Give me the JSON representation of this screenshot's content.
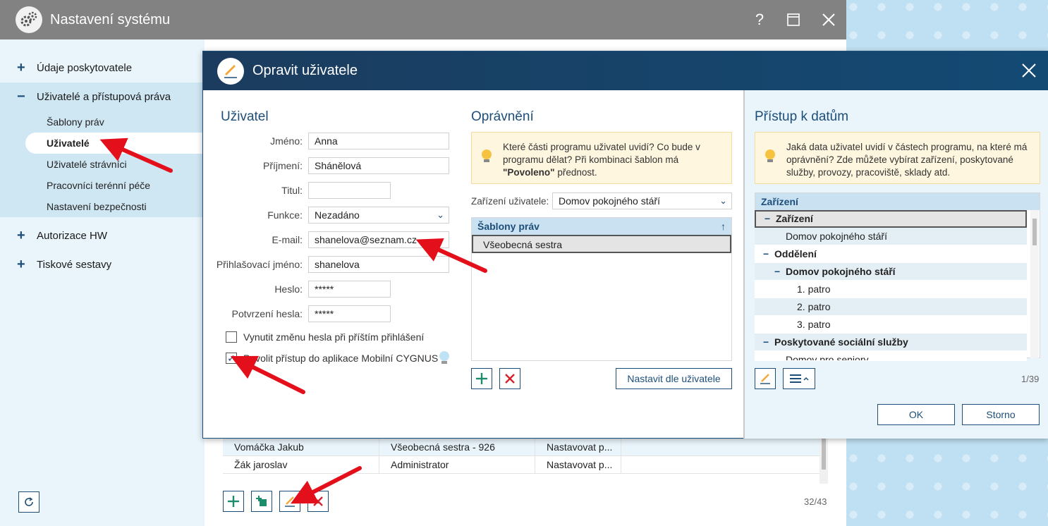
{
  "window": {
    "title": "Nastavení systému",
    "help_label": "?",
    "maximize_label": "☐",
    "close_label": "✕"
  },
  "sidebar": {
    "groups": [
      {
        "sign": "+",
        "label": "Údaje poskytovatele"
      },
      {
        "sign": "−",
        "label": "Uživatelé a přístupová práva"
      },
      {
        "sign": "+",
        "label": "Autorizace HW"
      },
      {
        "sign": "+",
        "label": "Tiskové sestavy"
      }
    ],
    "subitems": [
      "Šablony práv",
      "Uživatelé",
      "Uživatelé strávníci",
      "Pracovníci terénní péče",
      "Nastavení bezpečnosti"
    ],
    "active_subitem": "Uživatelé"
  },
  "users_table": {
    "rows": [
      [
        "Vomáčka Jakub",
        "Všeobecná sestra - 926",
        "Nastavovat p..."
      ],
      [
        "Žák jaroslav",
        "Administrator",
        "Nastavovat p..."
      ]
    ],
    "count": "32/43"
  },
  "dialog": {
    "title": "Opravit uživatele",
    "close_label": "✕",
    "user_section": {
      "title": "Uživatel",
      "fields": {
        "first_name_label": "Jméno:",
        "first_name": "Anna",
        "last_name_label": "Příjmení:",
        "last_name": "Shánělová",
        "title_label": "Titul:",
        "title": "",
        "function_label": "Funkce:",
        "function": "Nezadáno",
        "email_label": "E-mail:",
        "email": "shanelova@seznam.cz",
        "login_label": "Přihlašovací jméno:",
        "login": "shanelova",
        "password_label": "Heslo:",
        "password": "*****",
        "password_confirm_label": "Potvrzení hesla:",
        "password_confirm": "*****"
      },
      "force_change_label": "Vynutit změnu hesla při příštím přihlášení",
      "force_change_checked": false,
      "mobile_access_label": "Povolit přístup do aplikace Mobilní CYGNUS",
      "mobile_access_checked": true
    },
    "permissions_section": {
      "title": "Oprávnění",
      "info_line1": "Které části programu uživatel uvidí? Co bude v",
      "info_line2": "programu dělat? Při kombinaci šablon má",
      "info_bold": "\"Povoleno\"",
      "info_line3_rest": " přednost.",
      "facility_label": "Zařízení uživatele:",
      "facility_value": "Domov pokojného stáří",
      "templates_header": "Šablony práv",
      "templates": [
        "Všeobecná sestra"
      ],
      "set_by_user_button": "Nastavit dle uživatele"
    },
    "data_access_section": {
      "title": "Přístup k datům",
      "info_line1": "Jaká data uživatel uvidí v částech programu, na které má",
      "info_line2": "oprávnění? Zde můžete vybírat zařízení, poskytované",
      "info_line3": "služby, provozy, pracoviště, sklady atd.",
      "tree_header": "Zařízení",
      "tree": [
        {
          "text": "Zařízení",
          "sign": "−",
          "level": 0,
          "bold": true
        },
        {
          "text": "Domov pokojného stáří",
          "sign": "",
          "level": 1,
          "bold": false
        },
        {
          "text": "Oddělení",
          "sign": "−",
          "level": 0,
          "bold": true
        },
        {
          "text": "Domov pokojného stáří",
          "sign": "−",
          "level": 1,
          "bold": true
        },
        {
          "text": "1. patro",
          "sign": "",
          "level": 2,
          "bold": false
        },
        {
          "text": "2. patro",
          "sign": "",
          "level": 2,
          "bold": false
        },
        {
          "text": "3. patro",
          "sign": "",
          "level": 2,
          "bold": false
        },
        {
          "text": "Poskytované sociální služby",
          "sign": "−",
          "level": 0,
          "bold": true
        },
        {
          "text": "Domov pro seniory",
          "sign": "",
          "level": 1,
          "bold": false
        }
      ],
      "count": "1/39",
      "ok_button": "OK",
      "cancel_button": "Storno"
    }
  },
  "colors": {
    "accent": "#1d4e7a",
    "header": "#1b3c5e",
    "titlebar": "#828282",
    "arrow": "#e3101b",
    "info_bg": "#fff6df"
  }
}
